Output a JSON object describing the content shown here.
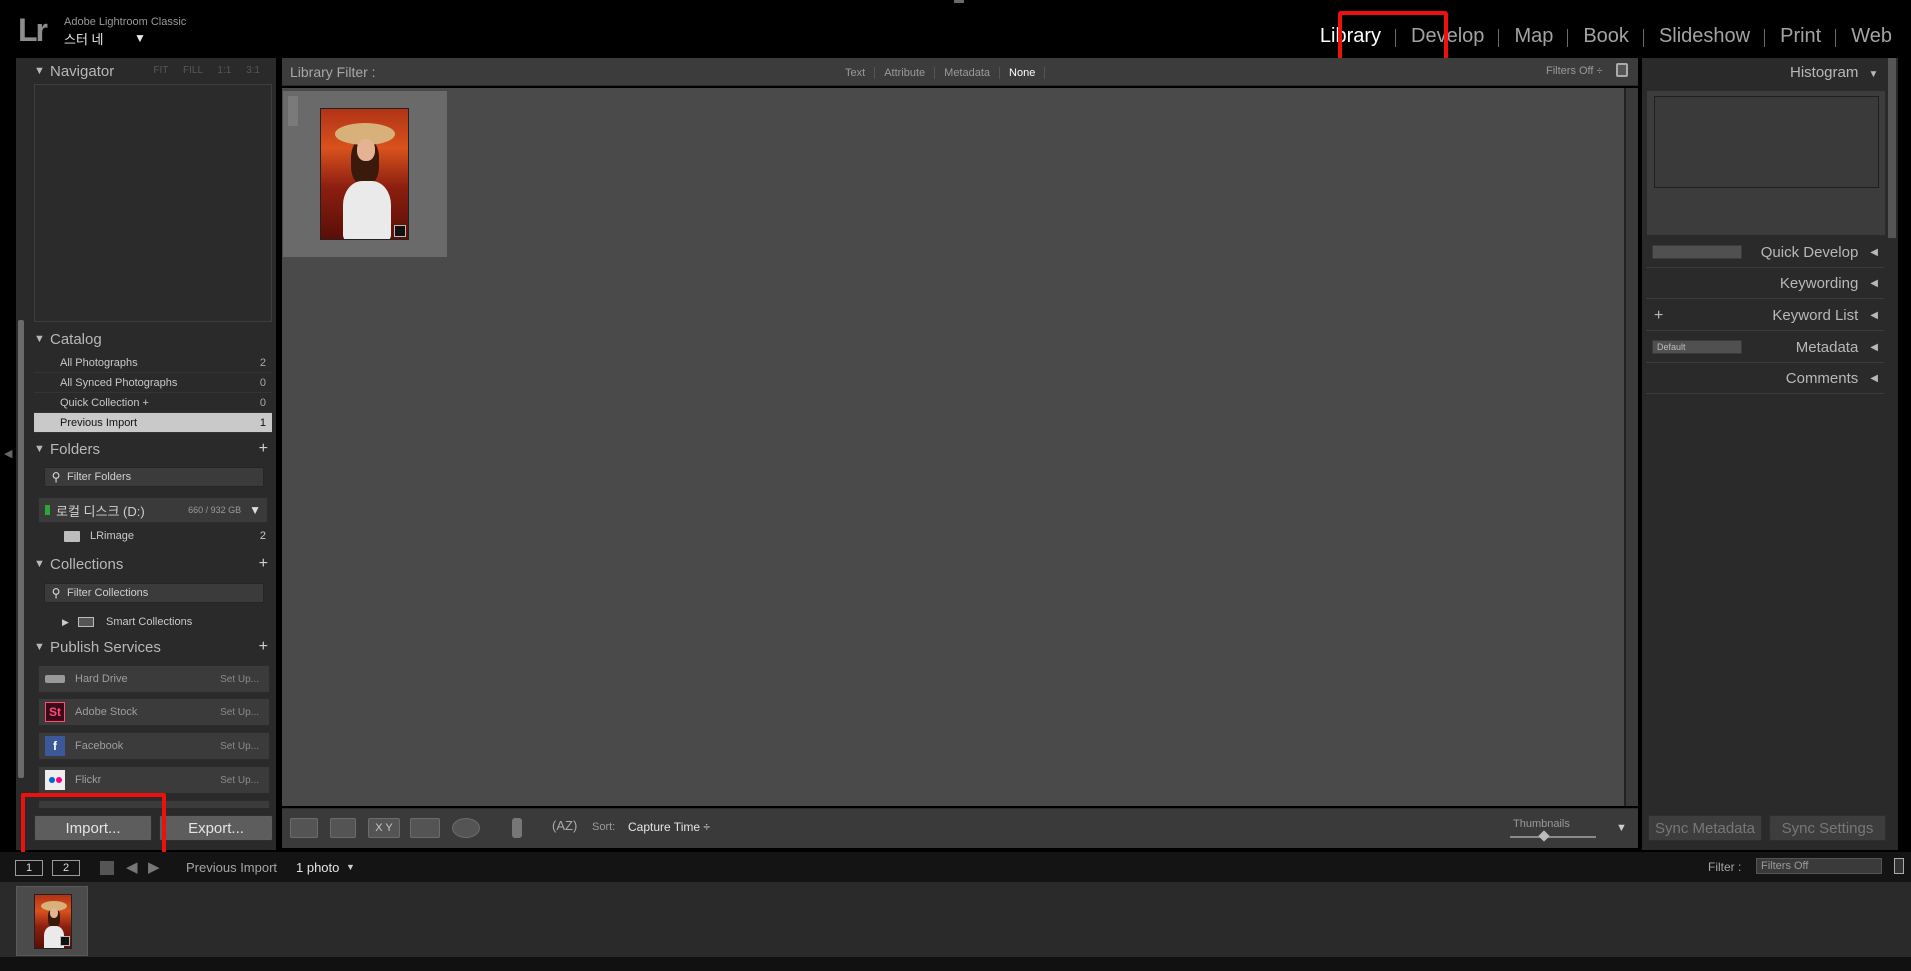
{
  "app": {
    "logo": "Lr",
    "name": "Adobe Lightroom Classic",
    "catalog": "스터 네",
    "identity_arrow": "▼"
  },
  "modules": [
    {
      "label": "Library",
      "active": true
    },
    {
      "label": "Develop",
      "active": false
    },
    {
      "label": "Map",
      "active": false
    },
    {
      "label": "Book",
      "active": false
    },
    {
      "label": "Slideshow",
      "active": false
    },
    {
      "label": "Print",
      "active": false
    },
    {
      "label": "Web",
      "active": false
    }
  ],
  "navigator": {
    "title": "Navigator",
    "zoom": "FIT FILL 1:1 3:1"
  },
  "catalog": {
    "title": "Catalog",
    "items": [
      {
        "label": "All Photographs",
        "count": "2"
      },
      {
        "label": "All Synced Photographs",
        "count": "0"
      },
      {
        "label": "Quick Collection  +",
        "count": "0"
      },
      {
        "label": "Previous Import",
        "count": "1"
      }
    ]
  },
  "folders": {
    "title": "Folders",
    "filter_placeholder": "Filter Folders",
    "volume": {
      "name": "로컬 디스크 (D:)",
      "size": "660 / 932 GB"
    },
    "items": [
      {
        "label": "LRimage",
        "count": "2"
      }
    ]
  },
  "collections": {
    "title": "Collections",
    "filter_placeholder": "Filter Collections",
    "items": [
      {
        "label": "Smart Collections"
      }
    ]
  },
  "publish": {
    "title": "Publish Services",
    "items": [
      {
        "label": "Hard Drive",
        "action": "Set Up..."
      },
      {
        "label": "Adobe Stock",
        "action": "Set Up...",
        "icon_text": "St"
      },
      {
        "label": "Facebook",
        "action": "Set Up...",
        "icon_text": "f"
      },
      {
        "label": "Flickr",
        "action": "Set Up..."
      }
    ]
  },
  "buttons": {
    "import": "Import...",
    "export": "Export...",
    "sync_metadata": "Sync Metadata",
    "sync_settings": "Sync Settings"
  },
  "library_filter": {
    "title": "Library Filter :",
    "tabs": [
      {
        "label": "Text",
        "active": false
      },
      {
        "label": "Attribute",
        "active": false
      },
      {
        "label": "Metadata",
        "active": false
      },
      {
        "label": "None",
        "active": true
      }
    ],
    "filters_off": "Filters Off ÷"
  },
  "toolbar": {
    "sort_label": "Sort:",
    "sort_value": "Capture Time ÷",
    "thumbnails_label": "Thumbnails",
    "survey_label": "X Y"
  },
  "right_panels": {
    "histogram": "Histogram",
    "quick_develop": "Quick Develop",
    "keywording": "Keywording",
    "keyword_list": "Keyword List",
    "metadata": "Metadata",
    "metadata_preset": "Default",
    "comments": "Comments"
  },
  "filmstrip": {
    "page1": "1",
    "page2": "2",
    "source": "Previous Import",
    "count": "1 photo",
    "filter_label": "Filter :",
    "filter_value": "Filters Off"
  },
  "colors": {
    "highlight": "#ee1010",
    "background": "#4a4a4a",
    "panel": "#2a2a2a"
  }
}
